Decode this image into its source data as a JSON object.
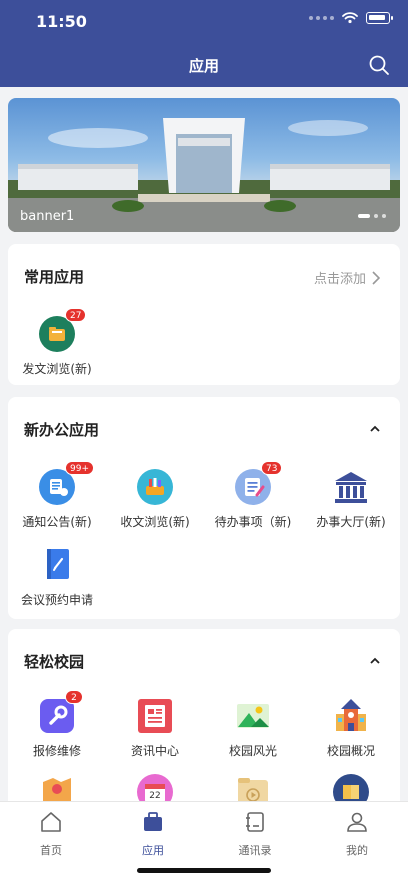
{
  "status": {
    "time": "11:50"
  },
  "header": {
    "title": "应用"
  },
  "banner": {
    "label": "banner1"
  },
  "common": {
    "title": "常用应用",
    "action": "点击添加",
    "apps": [
      {
        "label": "发文浏览(新)",
        "badge": "27"
      }
    ]
  },
  "office": {
    "title": "新办公应用",
    "apps": [
      {
        "label": "通知公告(新)",
        "badge": "99+"
      },
      {
        "label": "收文浏览(新)"
      },
      {
        "label": "待办事项（新)",
        "badge": "73"
      },
      {
        "label": "办事大厅(新)"
      },
      {
        "label": "会议预约申请"
      }
    ]
  },
  "campus": {
    "title": "轻松校园",
    "apps": [
      {
        "label": "报修维修",
        "badge": "2"
      },
      {
        "label": "资讯中心"
      },
      {
        "label": "校园风光"
      },
      {
        "label": "校园概况"
      }
    ],
    "row2_calendar_day": "22"
  },
  "tabs": [
    {
      "label": "首页"
    },
    {
      "label": "应用"
    },
    {
      "label": "通讯录"
    },
    {
      "label": "我的"
    }
  ],
  "colors": {
    "primary": "#3d4f9a",
    "badge": "#e5322d"
  }
}
